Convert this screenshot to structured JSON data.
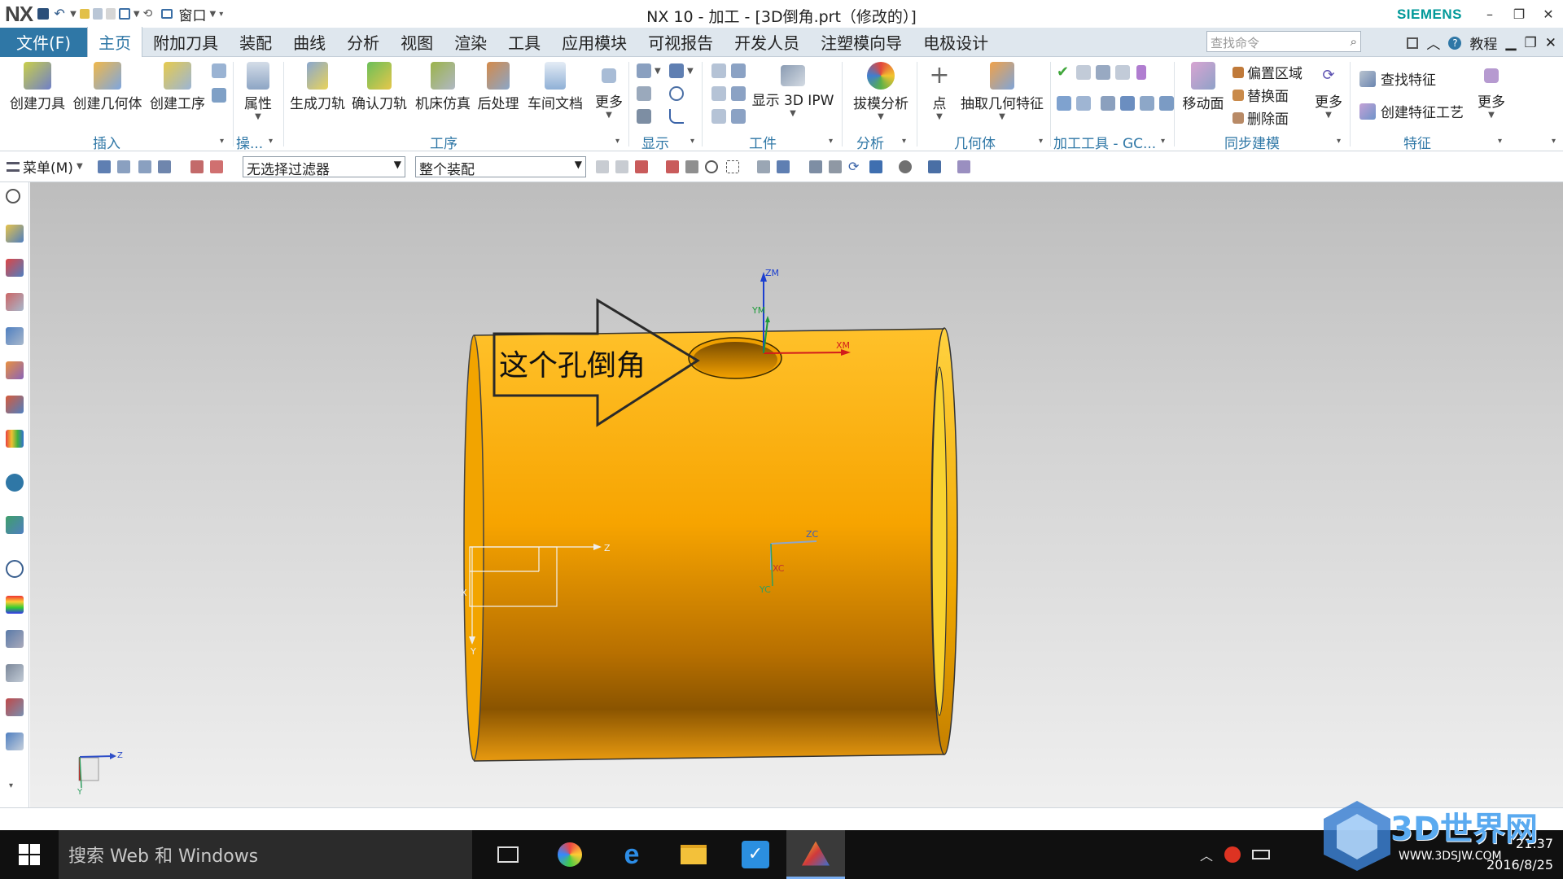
{
  "titlebar": {
    "logo": "NX",
    "window_menu": "窗口",
    "title": "NX 10 - 加工 - [3D倒角.prt（修改的）]",
    "brand": "SIEMENS",
    "colors": {
      "brand": "#009999"
    }
  },
  "menubar": {
    "file_tab": "文件(F)",
    "tabs": [
      "主页",
      "附加刀具",
      "装配",
      "曲线",
      "分析",
      "视图",
      "渲染",
      "工具",
      "应用模块",
      "可视报告",
      "开发人员",
      "注塑模向导",
      "电极设计"
    ],
    "active_tab": "主页",
    "search_placeholder": "查找命令",
    "tutorial": "教程",
    "colors": {
      "file_tab_bg": "#2f77a6",
      "bar_bg": "#dfe7ee"
    }
  },
  "ribbon": {
    "insert": {
      "create_tool": "创建刀具",
      "create_geometry": "创建几何体",
      "create_operation": "创建工序",
      "label": "插入"
    },
    "ops": {
      "properties": "属性",
      "label": "操..."
    },
    "operation": {
      "generate_path": "生成刀轨",
      "verify_path": "确认刀轨",
      "machine_sim": "机床仿真",
      "postprocess": "后处理",
      "shop_docs": "车间文档",
      "more": "更多",
      "label": "工序"
    },
    "display": {
      "label": "显示"
    },
    "workpiece": {
      "show_ipw": "显示 3D IPW",
      "label": "工件"
    },
    "analysis": {
      "draft_analysis": "拔模分析",
      "label": "分析"
    },
    "geometry": {
      "point": "点",
      "extract_geometry": "抽取几何特征",
      "label": "几何体"
    },
    "machining_tools": {
      "label": "加工工具 - GC..."
    },
    "sync_modeling": {
      "move_face": "移动面",
      "offset_region": "偏置区域",
      "replace_face": "替换面",
      "delete_face": "删除面",
      "more": "更多",
      "label": "同步建模"
    },
    "features": {
      "find_features": "查找特征",
      "create_feature_process": "创建特征工艺",
      "more": "更多",
      "label": "特征"
    }
  },
  "selection_bar": {
    "menu": "菜单(M)",
    "filter_value": "无选择过滤器",
    "scope_value": "整个装配"
  },
  "viewport": {
    "callout_text": "这个孔倒角",
    "csys_labels": {
      "zm": "ZM",
      "ym": "YM",
      "xm": "XM",
      "zc": "ZC",
      "xc": "XC",
      "yc": "YC",
      "z": "Z",
      "x": "X",
      "y": "Y"
    },
    "colors": {
      "part": "#f5a800",
      "part_dark": "#8a5a00",
      "callout_stroke": "#2a2a2a"
    }
  },
  "taskbar": {
    "search_placeholder": "搜索 Web 和 Windows",
    "time": "21:37",
    "date": "2016/8/25",
    "watermark": "3D世界网",
    "watermark_url": "WWW.3DSJW.COM"
  }
}
